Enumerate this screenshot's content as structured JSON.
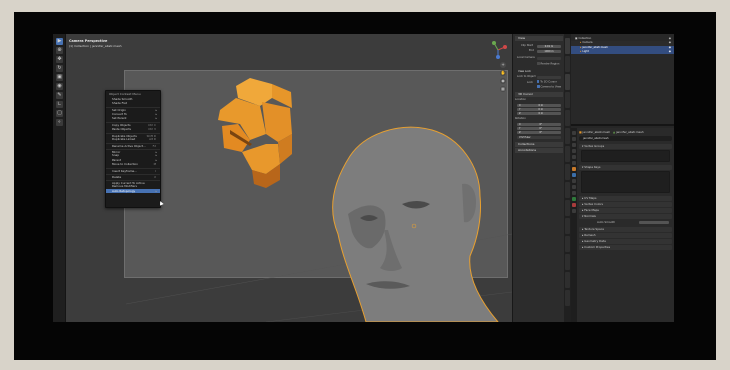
{
  "viewport": {
    "title": "Camera Perspective",
    "subtitle": "(1) Collection | jennifer_abstr.mesh"
  },
  "context_menu": {
    "title": "Object Context Menu",
    "items": [
      {
        "label": "Shade Smooth",
        "shortcut": "",
        "submenu": false,
        "sep": false,
        "highlight": false
      },
      {
        "label": "Shade Flat",
        "shortcut": "",
        "submenu": false,
        "sep": false,
        "highlight": false
      },
      {
        "label": "Set Origin",
        "shortcut": "",
        "submenu": true,
        "sep": true,
        "highlight": false
      },
      {
        "label": "Convert To",
        "shortcut": "",
        "submenu": true,
        "sep": false,
        "highlight": false
      },
      {
        "label": "Set Parent",
        "shortcut": "",
        "submenu": true,
        "sep": false,
        "highlight": false
      },
      {
        "label": "Copy Objects",
        "shortcut": "Ctrl C",
        "submenu": false,
        "sep": true,
        "highlight": false
      },
      {
        "label": "Paste Objects",
        "shortcut": "Ctrl V",
        "submenu": false,
        "sep": false,
        "highlight": false
      },
      {
        "label": "Duplicate Objects",
        "shortcut": "Shift D",
        "submenu": false,
        "sep": true,
        "highlight": false
      },
      {
        "label": "Duplicate Linked",
        "shortcut": "Alt D",
        "submenu": false,
        "sep": false,
        "highlight": false
      },
      {
        "label": "Rename Active Object...",
        "shortcut": "F2",
        "submenu": false,
        "sep": true,
        "highlight": false
      },
      {
        "label": "Mirror",
        "shortcut": "",
        "submenu": true,
        "sep": true,
        "highlight": false
      },
      {
        "label": "Snap",
        "shortcut": "",
        "submenu": true,
        "sep": false,
        "highlight": false
      },
      {
        "label": "Parent",
        "shortcut": "",
        "submenu": true,
        "sep": false,
        "highlight": false
      },
      {
        "label": "Move to Collection",
        "shortcut": "M",
        "submenu": false,
        "sep": false,
        "highlight": false
      },
      {
        "label": "Insert Keyframe...",
        "shortcut": "I",
        "submenu": false,
        "sep": true,
        "highlight": false
      },
      {
        "label": "Delete",
        "shortcut": "X",
        "submenu": false,
        "sep": true,
        "highlight": false
      },
      {
        "label": "Apply Current To Active",
        "shortcut": "",
        "submenu": false,
        "sep": true,
        "highlight": false
      },
      {
        "label": "Remove Modifiers",
        "shortcut": "",
        "submenu": false,
        "sep": false,
        "highlight": false
      },
      {
        "label": "Auto Retopology",
        "shortcut": "",
        "submenu": true,
        "sep": false,
        "highlight": true
      }
    ]
  },
  "npanel": {
    "view_header": "View",
    "clip_start_label": "Clip Start",
    "clip_start": "0.01 m",
    "clip_end_label": "End",
    "clip_end": "1000 m",
    "local_camera_label": "Local Camera",
    "render_region_label": "Render Region",
    "view_lock_header": "View Lock",
    "lock_to_object_label": "Lock to Object",
    "lock_label": "Lock",
    "to_3d_cursor_label": "To 3D Cursor",
    "camera_to_view_label": "Camera to View",
    "cursor_header": "3D Cursor",
    "location_label": "Location",
    "x_label": "X",
    "x_val": "0 m",
    "y_label": "Y",
    "y_val": "0 m",
    "z_label": "Z",
    "z_val": "0 m",
    "rotation_label": "Rotation",
    "rx_val": "0°",
    "ry_val": "0°",
    "rz_val": "0°",
    "mode_label": "XYZ Euler",
    "collections_header": "Collections",
    "annotations_header": "Annotations"
  },
  "outliner": {
    "rows": [
      {
        "label": "Collection",
        "sel": false,
        "indent": 0
      },
      {
        "label": "Camera",
        "sel": false,
        "indent": 1
      },
      {
        "label": "jennifer_abstr.mesh",
        "sel": true,
        "indent": 1
      },
      {
        "label": "Light",
        "sel": true,
        "indent": 1
      }
    ]
  },
  "properties": {
    "object_name": "jennifer_abstr.mesh",
    "pin_label": "jennifer_abstr.mesh",
    "data_name": "jennifer_abstr.mesh",
    "vertex_groups": "Vertex Groups",
    "shape_keys": "Shape Keys",
    "uv_maps": "UV Maps",
    "vertex_colors": "Vertex Colors",
    "face_maps": "Face Maps",
    "normals": "Normals",
    "auto_smooth": "Auto Smooth",
    "texture_space": "Texture Space",
    "remesh": "Remesh",
    "geometry_data": "Geometry Data",
    "custom_properties": "Custom Properties"
  },
  "colors": {
    "accent": "#4772b3",
    "object_orange": "#e3962a",
    "selection_outline": "#e8a030"
  }
}
